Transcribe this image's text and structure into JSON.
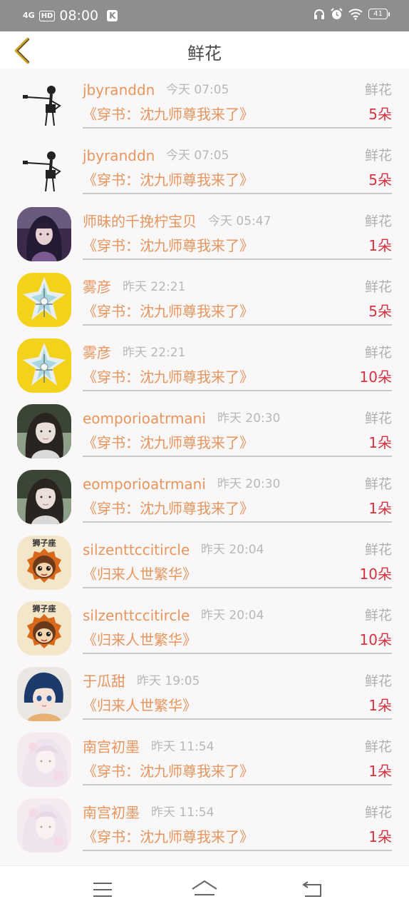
{
  "status_bar": {
    "network": "4G",
    "hd": "HD",
    "time": "08:00",
    "k_label": "K",
    "battery": "41"
  },
  "header": {
    "title": "鲜花"
  },
  "rows": [
    {
      "username": "jbyranddn",
      "time": "今天 07:05",
      "type": "鲜花",
      "book": "《穿书：沈九师尊我来了》",
      "count": "5朵",
      "avatar": "stickman"
    },
    {
      "username": "jbyranddn",
      "time": "今天 07:05",
      "type": "鲜花",
      "book": "《穿书：沈九师尊我来了》",
      "count": "5朵",
      "avatar": "stickman"
    },
    {
      "username": "师昧的千挽柠宝贝",
      "time": "今天 05:47",
      "type": "鲜花",
      "book": "《穿书：沈九师尊我来了》",
      "count": "1朵",
      "avatar": "anime-purple"
    },
    {
      "username": "雾彦",
      "time": "昨天 22:21",
      "type": "鲜花",
      "book": "《穿书：沈九师尊我来了》",
      "count": "5朵",
      "avatar": "yellow-emblem"
    },
    {
      "username": "雾彦",
      "time": "昨天 22:21",
      "type": "鲜花",
      "book": "《穿书：沈九师尊我来了》",
      "count": "10朵",
      "avatar": "yellow-emblem"
    },
    {
      "username": "eomporioatrmani",
      "time": "昨天 20:30",
      "type": "鲜花",
      "book": "《穿书：沈九师尊我来了》",
      "count": "1朵",
      "avatar": "photo-girl"
    },
    {
      "username": "eomporioatrmani",
      "time": "昨天 20:30",
      "type": "鲜花",
      "book": "《穿书：沈九师尊我来了》",
      "count": "1朵",
      "avatar": "photo-girl"
    },
    {
      "username": "silzenttccitircle",
      "time": "昨天 20:04",
      "type": "鲜花",
      "book": "《归来人世繁华》",
      "count": "10朵",
      "avatar": "lion-cartoon"
    },
    {
      "username": "silzenttccitircle",
      "time": "昨天 20:04",
      "type": "鲜花",
      "book": "《归来人世繁华》",
      "count": "10朵",
      "avatar": "lion-cartoon"
    },
    {
      "username": "于瓜甜",
      "time": "昨天 19:05",
      "type": "鲜花",
      "book": "《归来人世繁华》",
      "count": "1朵",
      "avatar": "anime-blue"
    },
    {
      "username": "南宫初墨",
      "time": "昨天 11:54",
      "type": "鲜花",
      "book": "《穿书：沈九师尊我来了》",
      "count": "1朵",
      "avatar": "anime-pale"
    },
    {
      "username": "南宫初墨",
      "time": "昨天 11:54",
      "type": "鲜花",
      "book": "《穿书：沈九师尊我来了》",
      "count": "1朵",
      "avatar": "anime-pale"
    }
  ],
  "lion_badge_text": "狮子座",
  "colors": {
    "username": "#e8955e",
    "count": "#d6323e",
    "meta": "#b8b8b8",
    "back_arrow": "#c9a227"
  }
}
